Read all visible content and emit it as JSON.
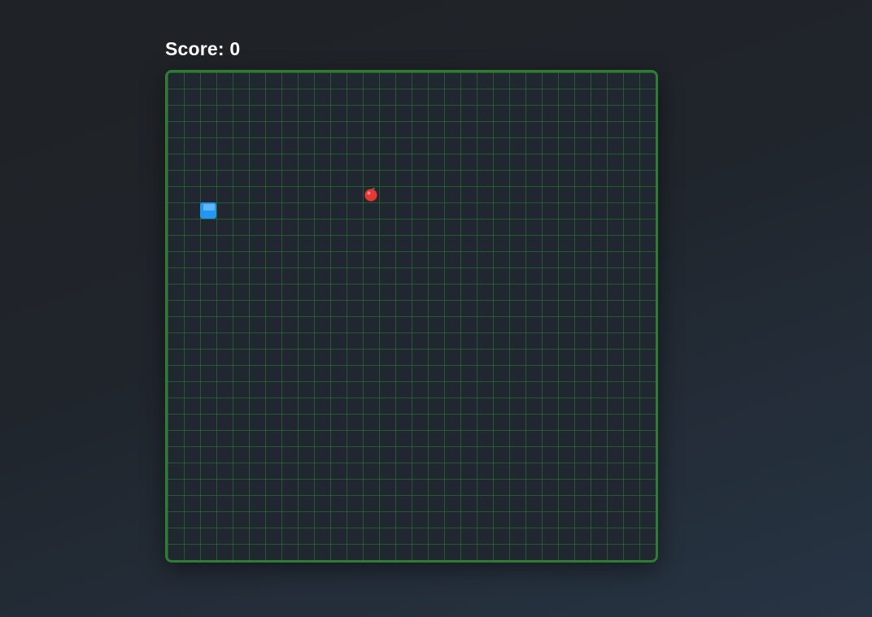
{
  "score": {
    "label": "Score: 0",
    "value": 0
  },
  "board": {
    "columns": 30,
    "rows": 30,
    "border_color": "#2e7d32",
    "grid_color": "#2e7d32",
    "background_color": "#212730"
  },
  "snake": {
    "color": "#2196f3",
    "highlight_color": "#64b5f6",
    "segments": [
      {
        "col": 2,
        "row": 8
      }
    ]
  },
  "food": {
    "icon": "apple-icon",
    "color": "#e53935",
    "leaf_color": "#43a047",
    "col": 12,
    "row": 7
  }
}
